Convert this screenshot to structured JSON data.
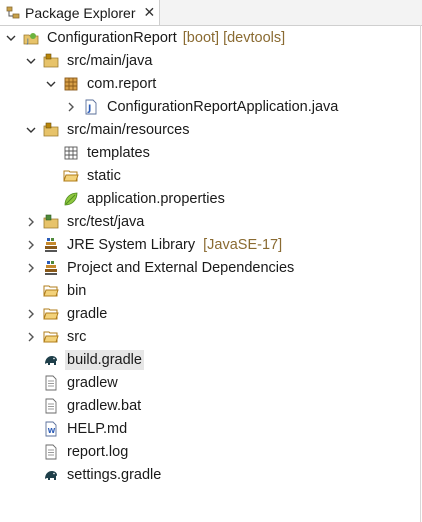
{
  "tab": {
    "title": "Package Explorer",
    "close": "✕"
  },
  "tree": {
    "project": {
      "name": "ConfigurationReport",
      "decoration": "[boot] [devtools]"
    },
    "src_main_java": "src/main/java",
    "com_report": "com.report",
    "app_java": "ConfigurationReportApplication.java",
    "src_main_resources": "src/main/resources",
    "templates": "templates",
    "static": "static",
    "application_properties": "application.properties",
    "src_test_java": "src/test/java",
    "jre": {
      "name": "JRE System Library",
      "decoration": "[JavaSE-17]"
    },
    "deps": "Project and External Dependencies",
    "bin": "bin",
    "gradle": "gradle",
    "src": "src",
    "build_gradle": "build.gradle",
    "gradlew": "gradlew",
    "gradlew_bat": "gradlew.bat",
    "help_md": "HELP.md",
    "report_log": "report.log",
    "settings_gradle": "settings.gradle"
  }
}
